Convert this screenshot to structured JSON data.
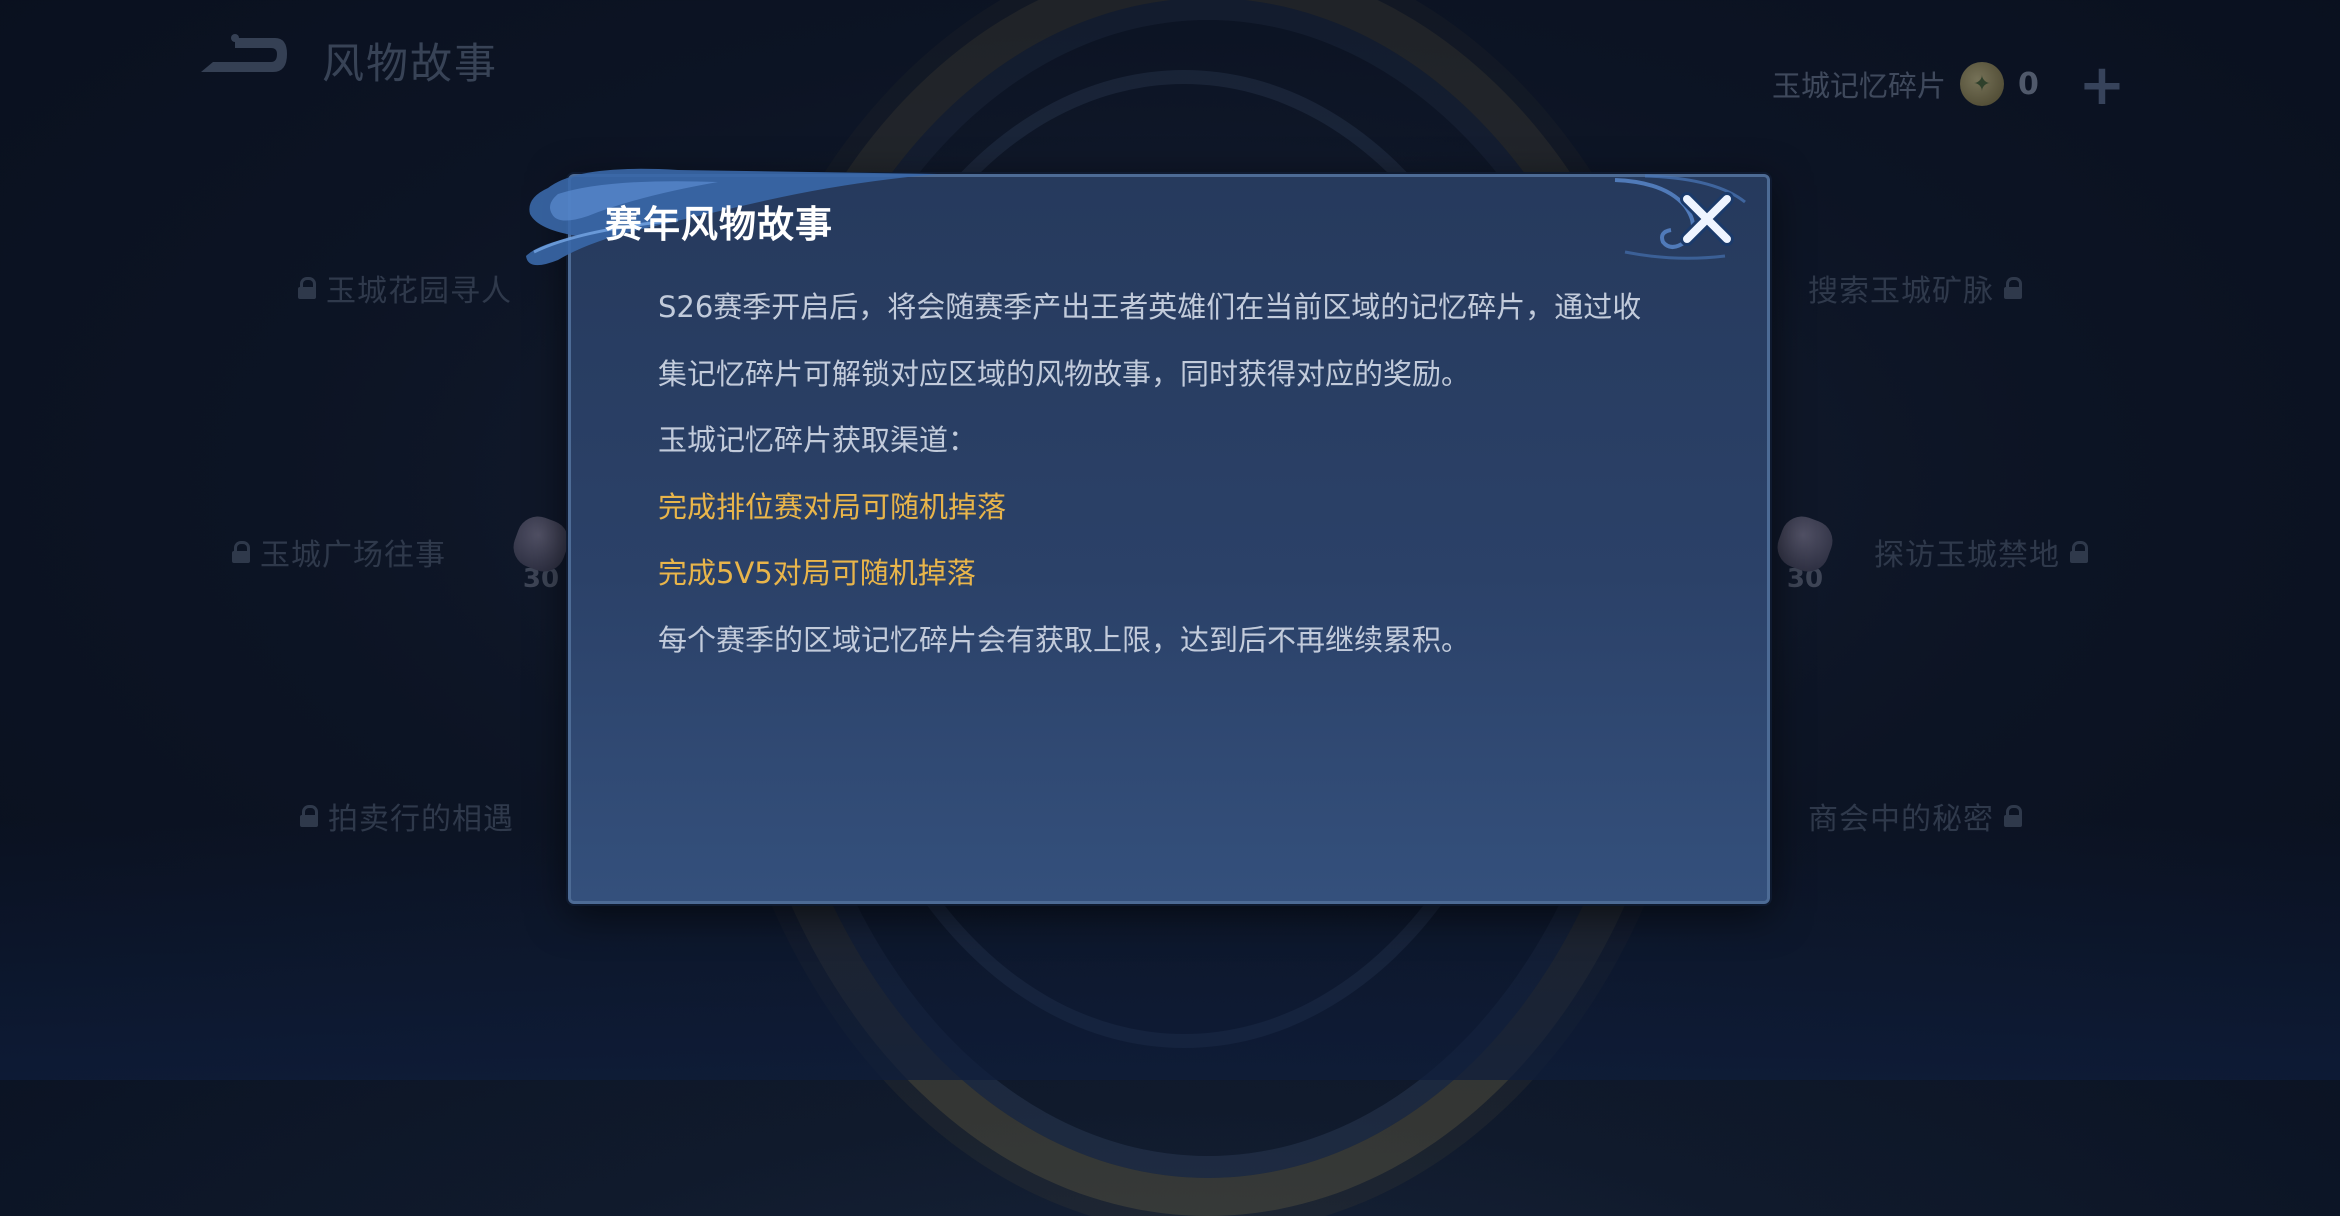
{
  "header": {
    "title": "风物故事",
    "back_icon": "back-arrow-icon"
  },
  "currency": {
    "label": "玉城记忆碎片",
    "count": "0",
    "icon": "memory-coin-icon",
    "add_icon": "plus-icon"
  },
  "background_nodes": [
    {
      "label": "玉城花园寻人"
    },
    {
      "label": "搜索玉城矿脉"
    },
    {
      "label": "玉城广场往事"
    },
    {
      "label": "探访玉城禁地"
    },
    {
      "label": "拍卖行的相遇"
    },
    {
      "label": "商会中的秘密"
    }
  ],
  "fragments": [
    {
      "count": "30"
    },
    {
      "count": "30"
    }
  ],
  "dialog": {
    "title": "赛年风物故事",
    "close_icon": "close-icon",
    "lines": [
      "S26赛季开启后，将会随赛季产出王者英雄们在当前区域的记忆碎片，通过收",
      "集记忆碎片可解锁对应区域的风物故事，同时获得对应的奖励。",
      "玉城记忆碎片获取渠道：",
      "完成排位赛对局可随机掉落",
      "完成5V5对局可随机掉落",
      "每个赛季的区域记忆碎片会有获取上限，达到后不再继续累积。"
    ]
  },
  "colors": {
    "highlight": "#e9b54a",
    "body_text": "#c2cbdb",
    "dialog_bg": "#2b4168",
    "dialog_border": "#4d6b95"
  }
}
